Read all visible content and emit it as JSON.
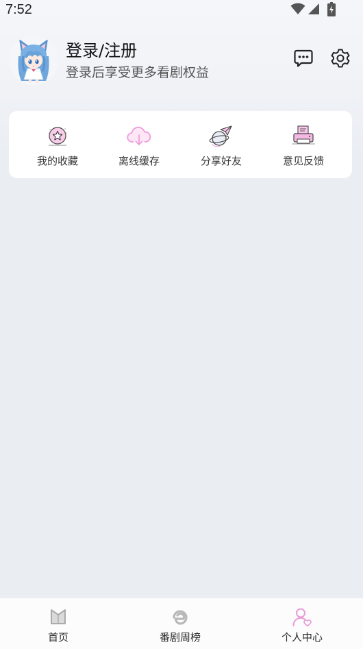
{
  "status_bar": {
    "time": "7:52",
    "icons": [
      "wifi-icon",
      "signal-icon",
      "battery-charging-icon"
    ]
  },
  "profile": {
    "avatar": "anime-avatar",
    "title": "登录/注册",
    "subtitle": "登录后享受更多看剧权益"
  },
  "header_actions": [
    {
      "icon": "message-icon"
    },
    {
      "icon": "settings-icon"
    }
  ],
  "quick_actions": [
    {
      "label": "我的收藏",
      "icon": "favorites-star-icon"
    },
    {
      "label": "离线缓存",
      "icon": "cloud-download-icon"
    },
    {
      "label": "分享好友",
      "icon": "share-plane-icon"
    },
    {
      "label": "意见反馈",
      "icon": "feedback-printer-icon"
    }
  ],
  "bottom_nav": [
    {
      "label": "首页",
      "icon": "home-icon",
      "active": false
    },
    {
      "label": "番剧周榜",
      "icon": "ranking-icon",
      "active": false
    },
    {
      "label": "个人中心",
      "icon": "profile-icon",
      "active": true
    }
  ],
  "colors": {
    "accent": "#ea9bd8",
    "background": "#eaedf2",
    "card": "#ffffff",
    "text_primary": "#111111",
    "text_secondary": "#555555",
    "nav_inactive_icon": "#a3a3a3"
  }
}
